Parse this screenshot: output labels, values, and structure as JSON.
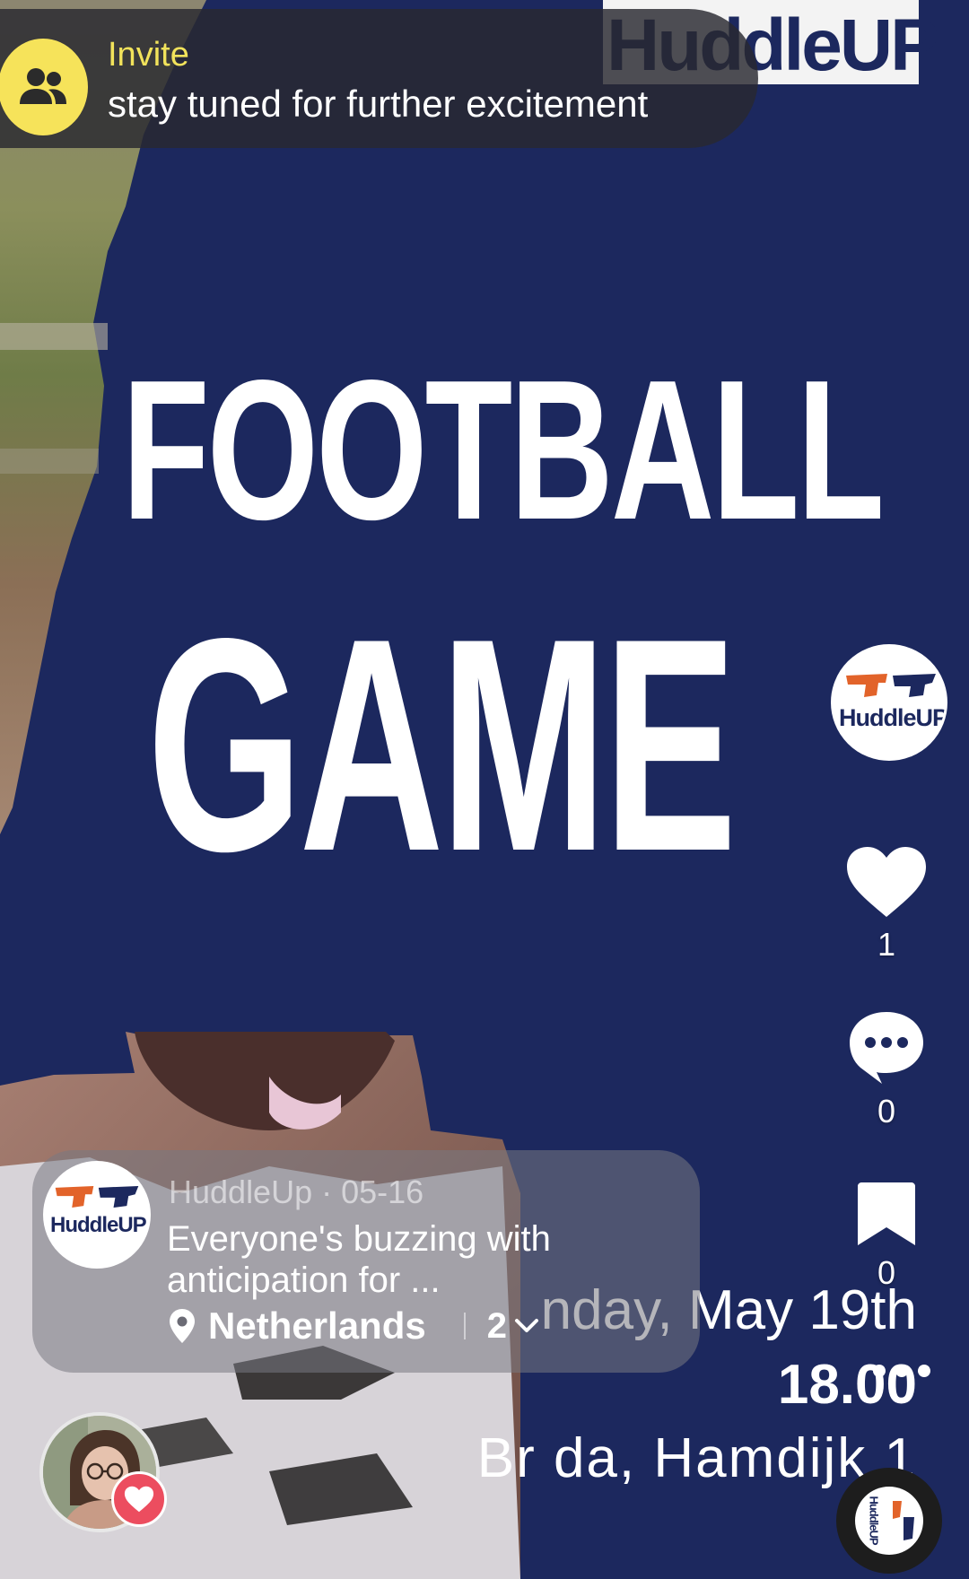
{
  "invite": {
    "title": "Invite",
    "subtitle": "stay tuned for further excitement",
    "icon": "users-icon"
  },
  "video": {
    "brand_text": "HuddleUP",
    "headline_line1": "FOOTBALL",
    "headline_line2": "GAME",
    "date_text": "nday, May 19th",
    "time_text": "18.00",
    "place_text": "Br  da, Hamdijk 1"
  },
  "creator": {
    "logo_text": "HuddleUP"
  },
  "actions": {
    "like_count": "1",
    "comment_count": "0",
    "bookmark_count": "0"
  },
  "caption": {
    "meta": "HuddleUp · 05-16",
    "text": "Everyone's buzzing with anticipation for ...",
    "location": "Netherlands",
    "count": "2"
  },
  "disc": {
    "logo_text": "HuddleUP"
  },
  "colors": {
    "navy": "#1c285e",
    "orange": "#e2632a",
    "invite_yellow": "#f6e35a",
    "like_red": "#ec4d5f"
  }
}
